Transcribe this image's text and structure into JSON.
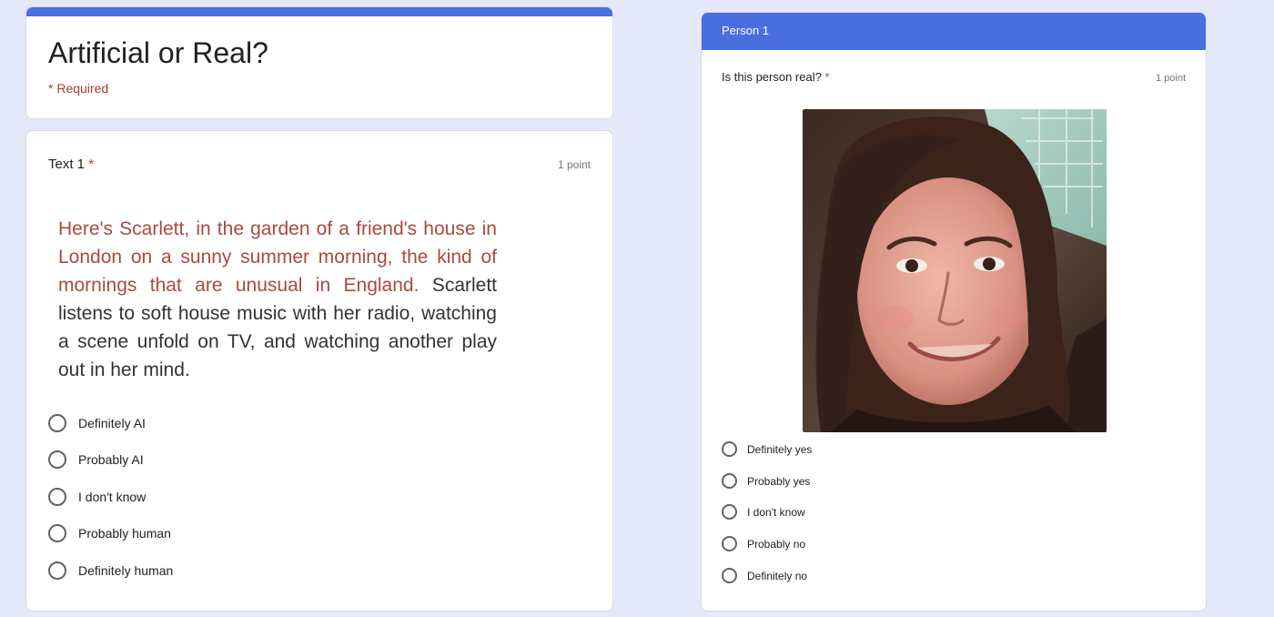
{
  "form": {
    "title": "Artificial or Real?",
    "required_note": "* Required",
    "accent_color": "#4a6ee0",
    "background_color": "#e4e8f8"
  },
  "text_question": {
    "title": "Text 1",
    "required_marker": "*",
    "points": "1 point",
    "passage_highlight": "Here's Scarlett, in the garden of a friend's house in London on a sunny summer morning, the kind of mornings that are unusual in England.",
    "passage_rest": " Scarlett listens to soft house music with her radio, watching a scene unfold on TV, and watching another play out in her mind.",
    "options": [
      "Definitely AI",
      "Probably AI",
      "I don't know",
      "Probably human",
      "Definitely human"
    ]
  },
  "person_question": {
    "section_header": "Person 1",
    "title": "Is this person real?",
    "required_marker": "*",
    "points": "1 point",
    "image_description": "portrait photo of a smiling young woman with long dark hair",
    "options": [
      "Definitely yes",
      "Probably yes",
      "I don't know",
      "Probably no",
      "Definitely no"
    ]
  }
}
